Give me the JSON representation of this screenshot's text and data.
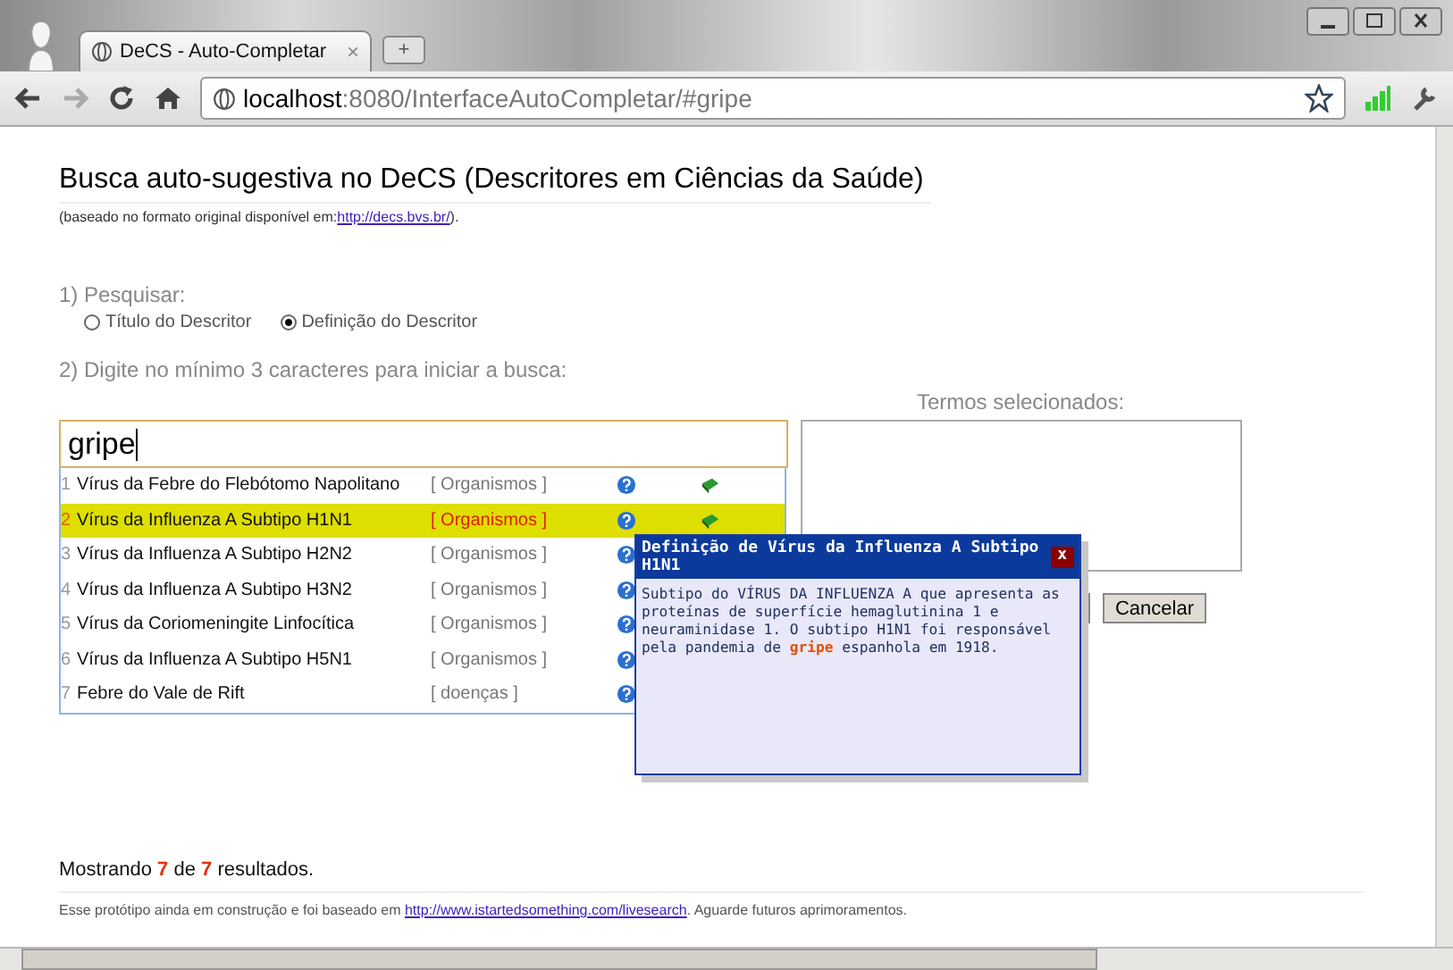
{
  "browser": {
    "tab_title": "DeCS - Auto-Completar",
    "tab_close": "×",
    "new_tab": "+",
    "url_host": "localhost",
    "url_rest": ":8080/InterfaceAutoCompletar/#gripe"
  },
  "page": {
    "title": "Busca auto-sugestiva no DeCS (Descritores em Ciências da Saúde)",
    "subtitle": "(baseado no formato original disponível em:",
    "subtitle_link": "http://decs.bvs.br/",
    "subtitle_end": ").",
    "search_label": "1) Pesquisar:",
    "radios": [
      {
        "label": "Título do Descritor",
        "selected": false
      },
      {
        "label": "Definição do Descritor",
        "selected": true
      }
    ],
    "prompt": "2) Digite no mínimo 3 caracteres para iniciar a busca:",
    "query": "gripe",
    "results": [
      {
        "number": "1",
        "name": "Vírus da Febre do Flebótomo Napolitano",
        "category": "[ Organismos ]",
        "selected": false
      },
      {
        "number": "2",
        "name": "Vírus da Influenza A Subtipo H1N1",
        "category": "[ Organismos ]",
        "selected": true
      },
      {
        "number": "3",
        "name": "Vírus da Influenza A Subtipo H2N2",
        "category": "[ Organismos ]",
        "selected": false
      },
      {
        "number": "4",
        "name": "Vírus da Influenza A Subtipo H3N2",
        "category": "[ Organismos ]",
        "selected": false
      },
      {
        "number": "5",
        "name": "Vírus da Coriomeningite Linfocítica",
        "category": "[ Organismos ]",
        "selected": false
      },
      {
        "number": "6",
        "name": "Vírus da Influenza A Subtipo H5N1",
        "category": "[ Organismos ]",
        "selected": false
      },
      {
        "number": "7",
        "name": "Febre do Vale de Rift",
        "category": "[ doenças ]",
        "selected": false
      }
    ],
    "selected_terms_label": "Termos selecionados:",
    "cancel_button": "Cancelar",
    "popup": {
      "title": "Definição de Vírus da Influenza A Subtipo H1N1",
      "close": "x",
      "body": "Subtipo do VÍRUS DA INFLUENZA A que apresenta as proteínas de superfície hemaglutinina 1 e neuraminidase 1. O subtipo H1N1 foi responsável pela pandemia de **gripe** espanhola em 1918."
    },
    "summary": "Mostrando **7** de **7** resultados.",
    "footer": "Esse protótipo ainda em construção e foi baseado em",
    "footer_link": "http://www.istartedsomething.com/livesearch",
    "footer_end": ". Aguarde futuros aprimoramentos."
  }
}
